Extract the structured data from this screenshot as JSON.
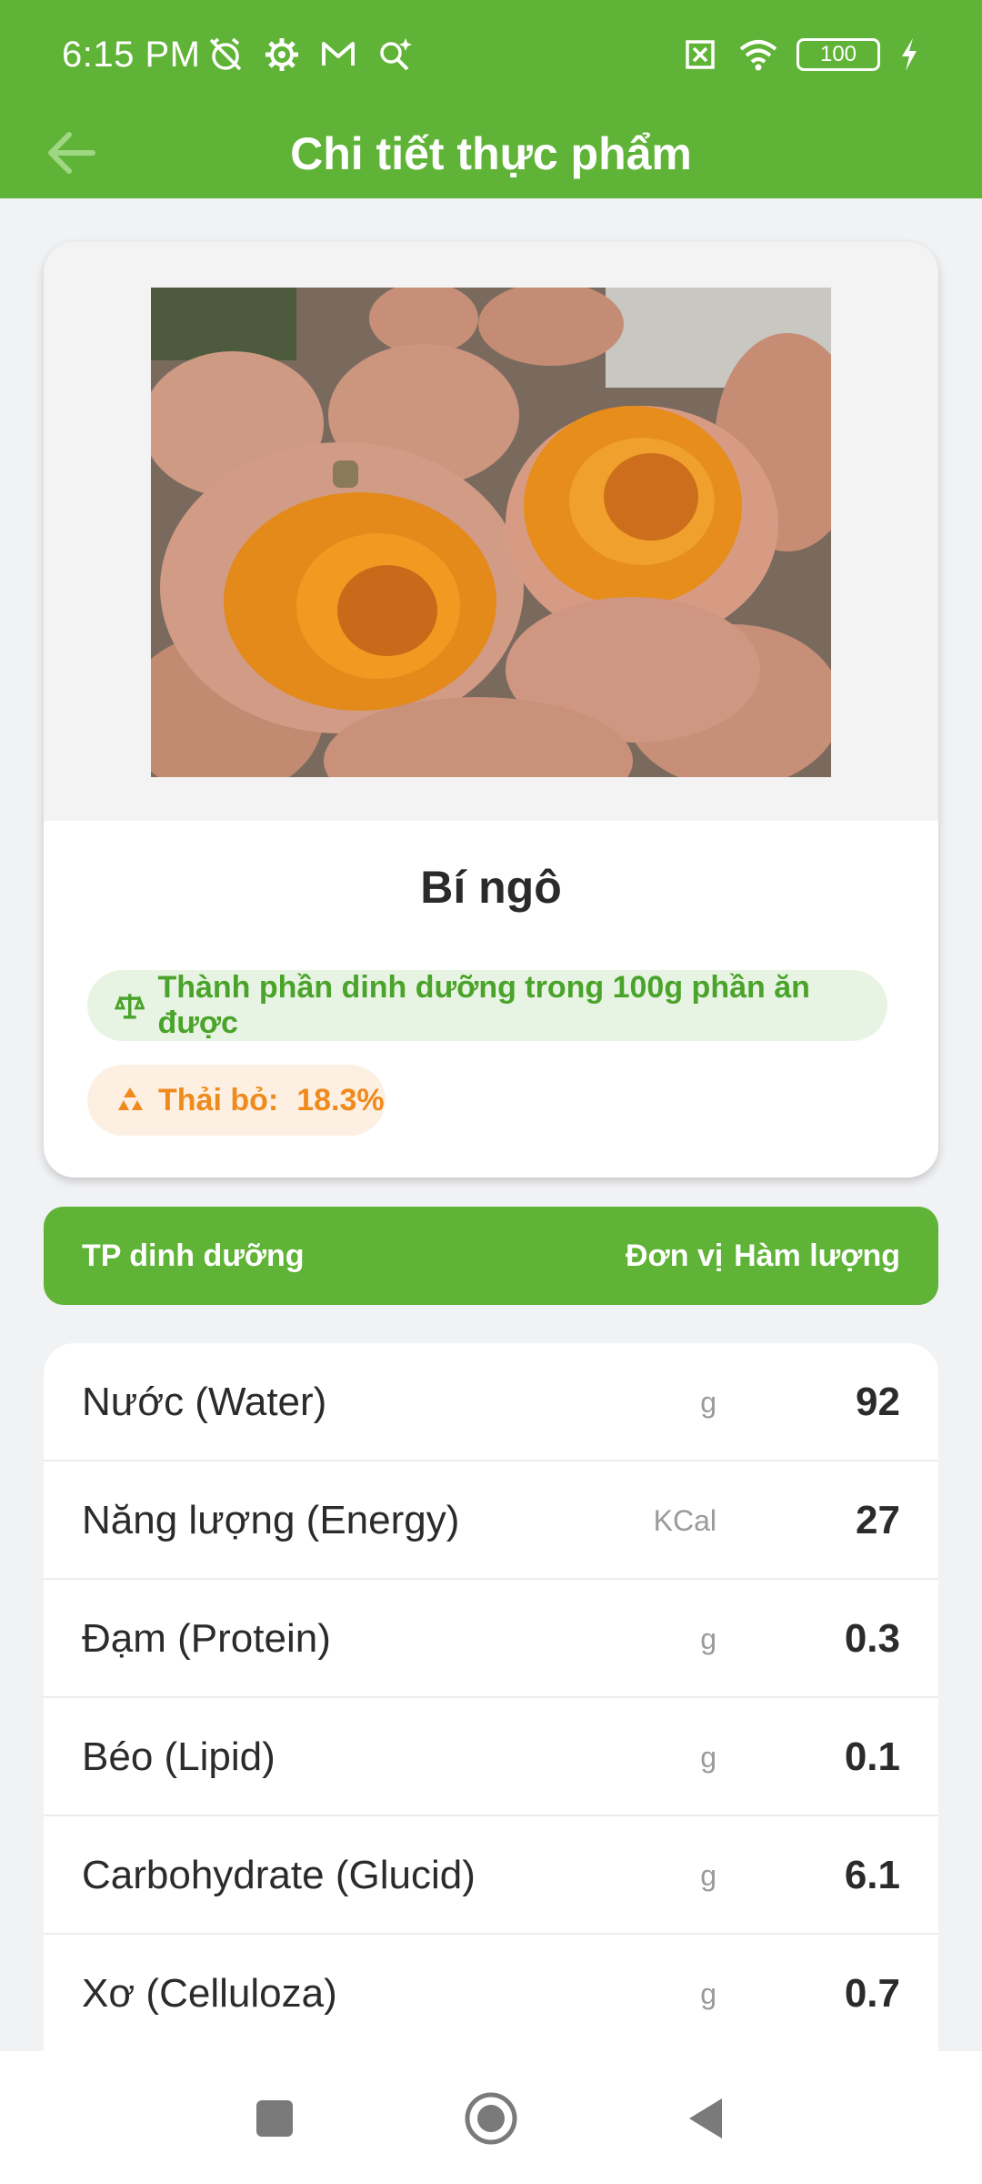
{
  "status_bar": {
    "time": "6:15 PM",
    "left_icons": [
      "alarm-off-icon",
      "settings-icon",
      "gmail-icon",
      "search-sparkle-icon"
    ],
    "right_icons": [
      "sim-x-icon",
      "wifi-icon",
      "battery-icon",
      "charging-icon"
    ],
    "battery": "100"
  },
  "app_bar": {
    "title": "Chi tiết thực phẩm",
    "back_icon": "arrow-left-icon"
  },
  "food": {
    "name": "Bí ngô",
    "nutrition_note": "Thành phần dinh dưỡng trong 100g phần ăn được",
    "waste_label": "Thải bỏ:",
    "waste_value": "18.3%"
  },
  "table": {
    "headers": {
      "name": "TP dinh dưỡng",
      "unit": "Đơn vị",
      "value": "Hàm lượng"
    },
    "rows": [
      {
        "name": "Nước (Water)",
        "unit": "g",
        "value": "92"
      },
      {
        "name": "Năng lượng (Energy)",
        "unit": "KCal",
        "value": "27"
      },
      {
        "name": "Đạm (Protein)",
        "unit": "g",
        "value": "0.3"
      },
      {
        "name": "Béo (Lipid)",
        "unit": "g",
        "value": "0.1"
      },
      {
        "name": "Carbohydrate (Glucid)",
        "unit": "g",
        "value": "6.1"
      },
      {
        "name": "Xơ (Celluloza)",
        "unit": "g",
        "value": "0.7"
      }
    ]
  },
  "colors": {
    "brand_green": "#5fb336",
    "green_pill_bg": "#e8f4e3",
    "orange": "#ef8a1d",
    "orange_pill_bg": "#fdf0e2"
  },
  "nav": [
    "recents-button",
    "home-button",
    "back-button"
  ]
}
